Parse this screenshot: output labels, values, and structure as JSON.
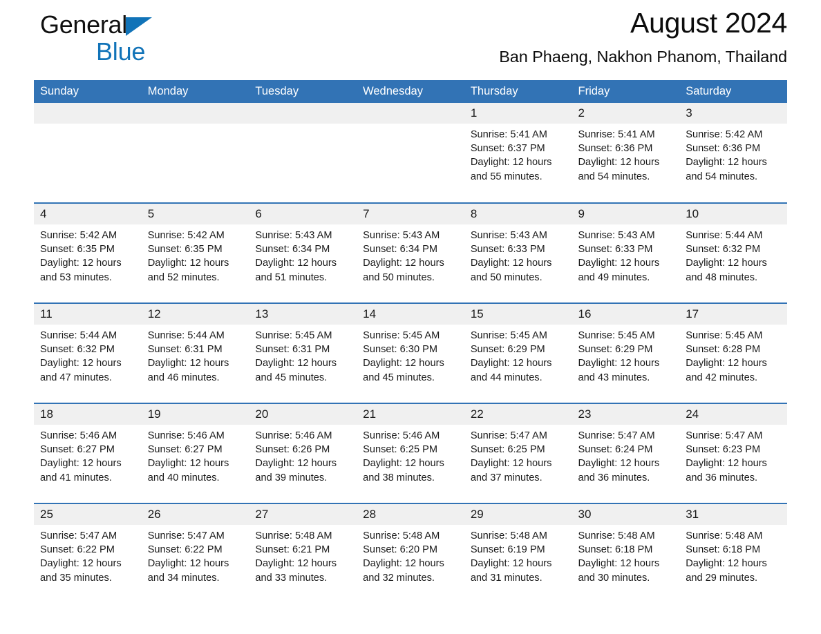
{
  "brand": {
    "word1": "General",
    "word2": "Blue",
    "triangle_color": "#1173b8"
  },
  "header": {
    "title": "August 2024",
    "subtitle": "Ban Phaeng, Nakhon Phanom, Thailand"
  },
  "colors": {
    "header_blue": "#3273b5",
    "daynum_band": "#f0f0f0",
    "brand_blue": "#1173b8",
    "text": "#1a1a1a"
  },
  "labels": {
    "sunrise_prefix": "Sunrise:",
    "sunset_prefix": "Sunset:",
    "daylight_prefix": "Daylight:"
  },
  "day_names": [
    "Sunday",
    "Monday",
    "Tuesday",
    "Wednesday",
    "Thursday",
    "Friday",
    "Saturday"
  ],
  "weeks": [
    [
      {
        "day": "",
        "sunrise": "",
        "sunset": "",
        "daylight1": "",
        "daylight2": ""
      },
      {
        "day": "",
        "sunrise": "",
        "sunset": "",
        "daylight1": "",
        "daylight2": ""
      },
      {
        "day": "",
        "sunrise": "",
        "sunset": "",
        "daylight1": "",
        "daylight2": ""
      },
      {
        "day": "",
        "sunrise": "",
        "sunset": "",
        "daylight1": "",
        "daylight2": ""
      },
      {
        "day": "1",
        "sunrise": "Sunrise: 5:41 AM",
        "sunset": "Sunset: 6:37 PM",
        "daylight1": "Daylight: 12 hours",
        "daylight2": "and 55 minutes."
      },
      {
        "day": "2",
        "sunrise": "Sunrise: 5:41 AM",
        "sunset": "Sunset: 6:36 PM",
        "daylight1": "Daylight: 12 hours",
        "daylight2": "and 54 minutes."
      },
      {
        "day": "3",
        "sunrise": "Sunrise: 5:42 AM",
        "sunset": "Sunset: 6:36 PM",
        "daylight1": "Daylight: 12 hours",
        "daylight2": "and 54 minutes."
      }
    ],
    [
      {
        "day": "4",
        "sunrise": "Sunrise: 5:42 AM",
        "sunset": "Sunset: 6:35 PM",
        "daylight1": "Daylight: 12 hours",
        "daylight2": "and 53 minutes."
      },
      {
        "day": "5",
        "sunrise": "Sunrise: 5:42 AM",
        "sunset": "Sunset: 6:35 PM",
        "daylight1": "Daylight: 12 hours",
        "daylight2": "and 52 minutes."
      },
      {
        "day": "6",
        "sunrise": "Sunrise: 5:43 AM",
        "sunset": "Sunset: 6:34 PM",
        "daylight1": "Daylight: 12 hours",
        "daylight2": "and 51 minutes."
      },
      {
        "day": "7",
        "sunrise": "Sunrise: 5:43 AM",
        "sunset": "Sunset: 6:34 PM",
        "daylight1": "Daylight: 12 hours",
        "daylight2": "and 50 minutes."
      },
      {
        "day": "8",
        "sunrise": "Sunrise: 5:43 AM",
        "sunset": "Sunset: 6:33 PM",
        "daylight1": "Daylight: 12 hours",
        "daylight2": "and 50 minutes."
      },
      {
        "day": "9",
        "sunrise": "Sunrise: 5:43 AM",
        "sunset": "Sunset: 6:33 PM",
        "daylight1": "Daylight: 12 hours",
        "daylight2": "and 49 minutes."
      },
      {
        "day": "10",
        "sunrise": "Sunrise: 5:44 AM",
        "sunset": "Sunset: 6:32 PM",
        "daylight1": "Daylight: 12 hours",
        "daylight2": "and 48 minutes."
      }
    ],
    [
      {
        "day": "11",
        "sunrise": "Sunrise: 5:44 AM",
        "sunset": "Sunset: 6:32 PM",
        "daylight1": "Daylight: 12 hours",
        "daylight2": "and 47 minutes."
      },
      {
        "day": "12",
        "sunrise": "Sunrise: 5:44 AM",
        "sunset": "Sunset: 6:31 PM",
        "daylight1": "Daylight: 12 hours",
        "daylight2": "and 46 minutes."
      },
      {
        "day": "13",
        "sunrise": "Sunrise: 5:45 AM",
        "sunset": "Sunset: 6:31 PM",
        "daylight1": "Daylight: 12 hours",
        "daylight2": "and 45 minutes."
      },
      {
        "day": "14",
        "sunrise": "Sunrise: 5:45 AM",
        "sunset": "Sunset: 6:30 PM",
        "daylight1": "Daylight: 12 hours",
        "daylight2": "and 45 minutes."
      },
      {
        "day": "15",
        "sunrise": "Sunrise: 5:45 AM",
        "sunset": "Sunset: 6:29 PM",
        "daylight1": "Daylight: 12 hours",
        "daylight2": "and 44 minutes."
      },
      {
        "day": "16",
        "sunrise": "Sunrise: 5:45 AM",
        "sunset": "Sunset: 6:29 PM",
        "daylight1": "Daylight: 12 hours",
        "daylight2": "and 43 minutes."
      },
      {
        "day": "17",
        "sunrise": "Sunrise: 5:45 AM",
        "sunset": "Sunset: 6:28 PM",
        "daylight1": "Daylight: 12 hours",
        "daylight2": "and 42 minutes."
      }
    ],
    [
      {
        "day": "18",
        "sunrise": "Sunrise: 5:46 AM",
        "sunset": "Sunset: 6:27 PM",
        "daylight1": "Daylight: 12 hours",
        "daylight2": "and 41 minutes."
      },
      {
        "day": "19",
        "sunrise": "Sunrise: 5:46 AM",
        "sunset": "Sunset: 6:27 PM",
        "daylight1": "Daylight: 12 hours",
        "daylight2": "and 40 minutes."
      },
      {
        "day": "20",
        "sunrise": "Sunrise: 5:46 AM",
        "sunset": "Sunset: 6:26 PM",
        "daylight1": "Daylight: 12 hours",
        "daylight2": "and 39 minutes."
      },
      {
        "day": "21",
        "sunrise": "Sunrise: 5:46 AM",
        "sunset": "Sunset: 6:25 PM",
        "daylight1": "Daylight: 12 hours",
        "daylight2": "and 38 minutes."
      },
      {
        "day": "22",
        "sunrise": "Sunrise: 5:47 AM",
        "sunset": "Sunset: 6:25 PM",
        "daylight1": "Daylight: 12 hours",
        "daylight2": "and 37 minutes."
      },
      {
        "day": "23",
        "sunrise": "Sunrise: 5:47 AM",
        "sunset": "Sunset: 6:24 PM",
        "daylight1": "Daylight: 12 hours",
        "daylight2": "and 36 minutes."
      },
      {
        "day": "24",
        "sunrise": "Sunrise: 5:47 AM",
        "sunset": "Sunset: 6:23 PM",
        "daylight1": "Daylight: 12 hours",
        "daylight2": "and 36 minutes."
      }
    ],
    [
      {
        "day": "25",
        "sunrise": "Sunrise: 5:47 AM",
        "sunset": "Sunset: 6:22 PM",
        "daylight1": "Daylight: 12 hours",
        "daylight2": "and 35 minutes."
      },
      {
        "day": "26",
        "sunrise": "Sunrise: 5:47 AM",
        "sunset": "Sunset: 6:22 PM",
        "daylight1": "Daylight: 12 hours",
        "daylight2": "and 34 minutes."
      },
      {
        "day": "27",
        "sunrise": "Sunrise: 5:48 AM",
        "sunset": "Sunset: 6:21 PM",
        "daylight1": "Daylight: 12 hours",
        "daylight2": "and 33 minutes."
      },
      {
        "day": "28",
        "sunrise": "Sunrise: 5:48 AM",
        "sunset": "Sunset: 6:20 PM",
        "daylight1": "Daylight: 12 hours",
        "daylight2": "and 32 minutes."
      },
      {
        "day": "29",
        "sunrise": "Sunrise: 5:48 AM",
        "sunset": "Sunset: 6:19 PM",
        "daylight1": "Daylight: 12 hours",
        "daylight2": "and 31 minutes."
      },
      {
        "day": "30",
        "sunrise": "Sunrise: 5:48 AM",
        "sunset": "Sunset: 6:18 PM",
        "daylight1": "Daylight: 12 hours",
        "daylight2": "and 30 minutes."
      },
      {
        "day": "31",
        "sunrise": "Sunrise: 5:48 AM",
        "sunset": "Sunset: 6:18 PM",
        "daylight1": "Daylight: 12 hours",
        "daylight2": "and 29 minutes."
      }
    ]
  ]
}
